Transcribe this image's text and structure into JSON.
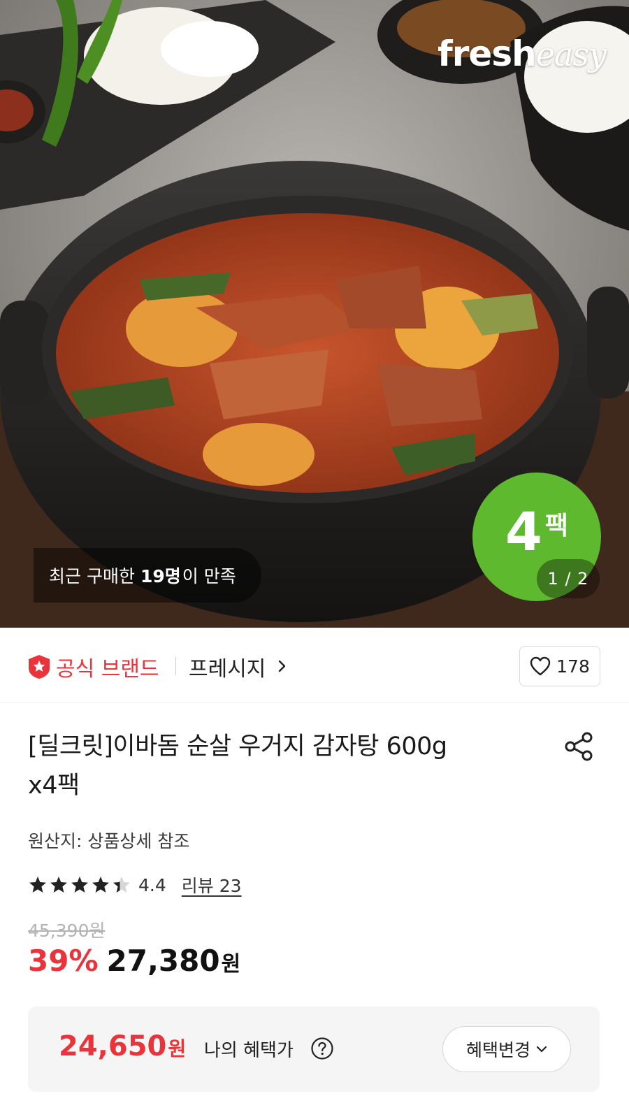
{
  "hero": {
    "brand_logo": {
      "fresh": "fresh",
      "easy": "easy"
    },
    "satisfaction": {
      "prefix": "최근 구매한",
      "count": "19명",
      "suffix": "이 만족"
    },
    "pack_badge": {
      "number": "4",
      "unit": "팩",
      "color": "#5fb92e"
    },
    "page_indicator": "1 / 2",
    "image_description_icon": "food-photo"
  },
  "brand_row": {
    "official_label": "공식 브랜드",
    "official_icon": "official-brand-badge-icon",
    "brand_name": "프레시지",
    "like_count": "178"
  },
  "product": {
    "title_line1": "[딜크릿]이바돔 순살 우거지 감자탕 600g",
    "title_line2": "x4팩",
    "origin": "원산지: 상품상세 참조",
    "rating": "4.4",
    "rating_stars_value": 4.4,
    "review_link": "리뷰 23",
    "original_price": "45,390원",
    "discount_rate": "39%",
    "sale_price": "27,380",
    "sale_currency": "원"
  },
  "benefit": {
    "price": "24,650",
    "currency": "원",
    "label": "나의 혜택가",
    "change_button": "혜택변경"
  },
  "colors": {
    "accent_red": "#e8343a",
    "badge_green": "#5fb92e",
    "benefit_bg": "#f5f5f5"
  }
}
